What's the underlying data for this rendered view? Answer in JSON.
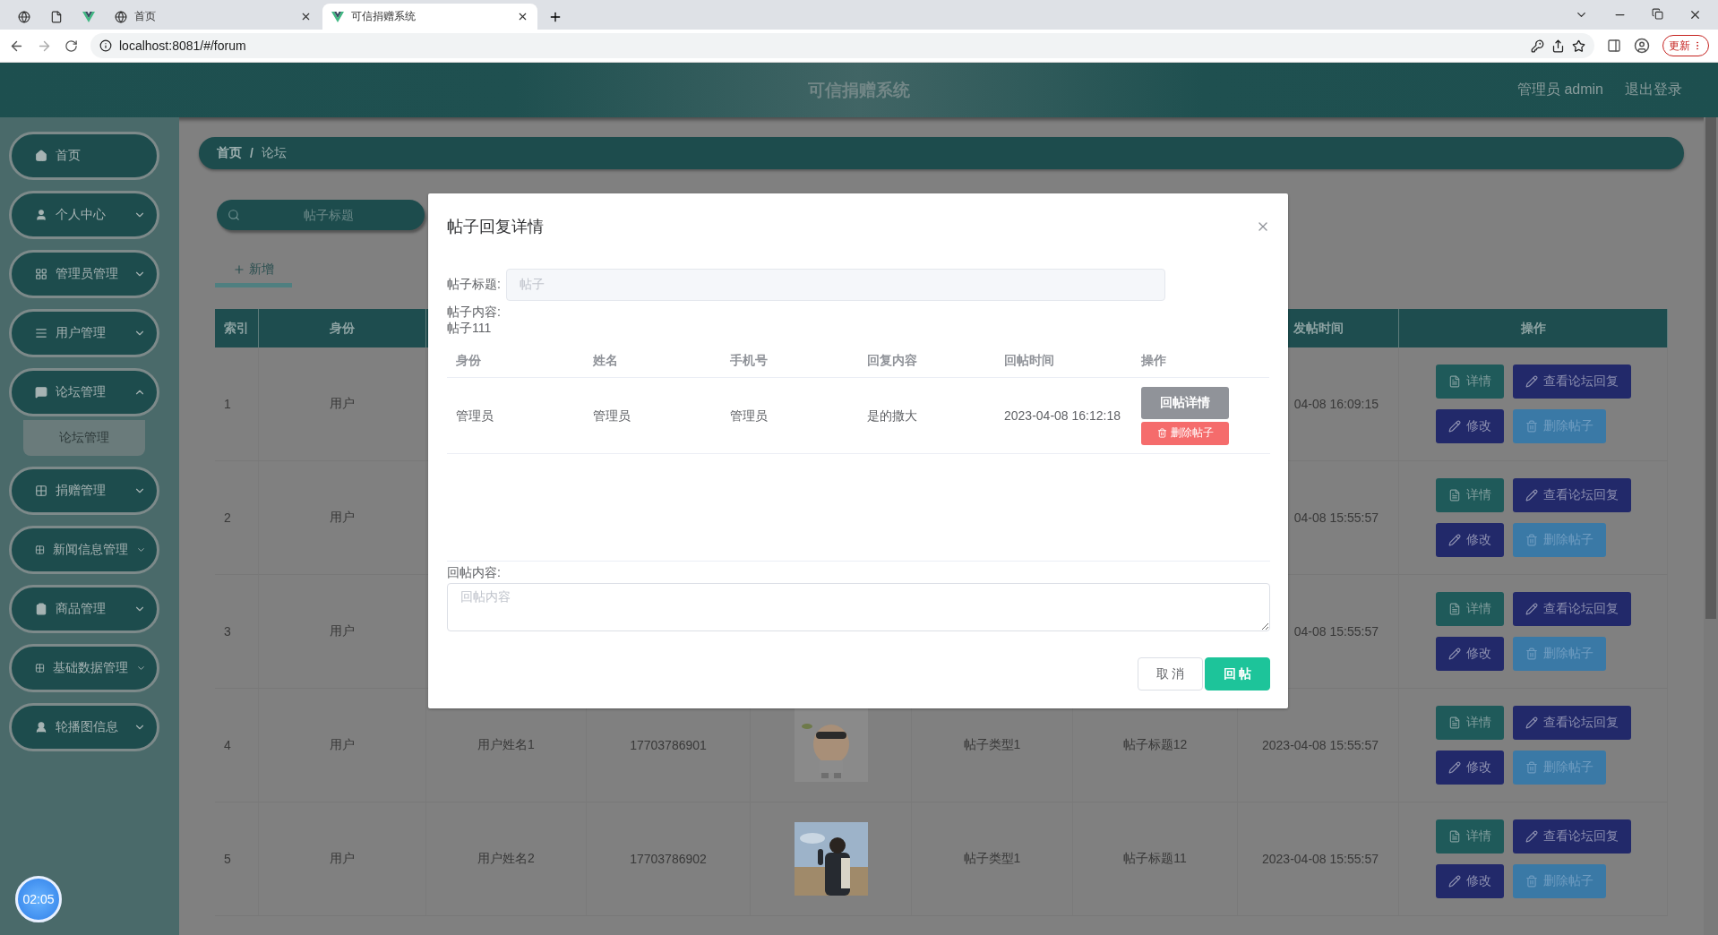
{
  "browser": {
    "tabs": [
      {
        "kind": "icon-only",
        "selected": false
      },
      {
        "kind": "icon-only",
        "selected": false
      },
      {
        "kind": "icon-only",
        "selected": false
      },
      {
        "kind": "titled",
        "title": "首页",
        "selected": false
      },
      {
        "kind": "titled",
        "title": "可信捐赠系统",
        "selected": true
      }
    ],
    "address": "localhost:8081/#/forum",
    "update_button": "更新"
  },
  "header": {
    "title": "可信捐赠系统",
    "user": "管理员 admin",
    "logout": "退出登录"
  },
  "sidebar": {
    "items": [
      {
        "kind": "link",
        "label": "首页"
      },
      {
        "kind": "menu",
        "label": "个人中心",
        "expanded": false
      },
      {
        "kind": "menu",
        "label": "管理员管理",
        "expanded": false
      },
      {
        "kind": "menu",
        "label": "用户管理",
        "expanded": false
      },
      {
        "kind": "menu",
        "label": "论坛管理",
        "expanded": true,
        "children": [
          {
            "label": "论坛管理"
          }
        ]
      },
      {
        "kind": "menu",
        "label": "捐赠管理",
        "expanded": false
      },
      {
        "kind": "menu",
        "label": "新闻信息管理",
        "expanded": false
      },
      {
        "kind": "menu",
        "label": "商品管理",
        "expanded": false
      },
      {
        "kind": "menu",
        "label": "基础数据管理",
        "expanded": false
      },
      {
        "kind": "menu",
        "label": "轮播图信息",
        "expanded": false
      }
    ]
  },
  "recorder_badge": "02:05",
  "breadcrumb": [
    "首页",
    "/",
    "论坛"
  ],
  "search": {
    "placeholder": "帖子标题"
  },
  "add_button": "新增",
  "table": {
    "headers": {
      "index": "索引",
      "identity": "身份",
      "time": "发帖时间",
      "actions": "操作"
    },
    "rows": [
      {
        "index": "1",
        "identity": "用户",
        "time": "04-08 16:09:15",
        "actions": [
          {
            "kind": "detail",
            "label": "详情"
          },
          {
            "kind": "replies",
            "label": "查看论坛回复"
          },
          {
            "kind": "edit",
            "label": "修改"
          },
          {
            "kind": "delete",
            "label": "删除帖子"
          }
        ]
      },
      {
        "index": "2",
        "identity": "用户",
        "time": "04-08 15:55:57",
        "actions": [
          {
            "kind": "detail",
            "label": "详情"
          },
          {
            "kind": "replies",
            "label": "查看论坛回复"
          },
          {
            "kind": "edit",
            "label": "修改"
          },
          {
            "kind": "delete",
            "label": "删除帖子"
          }
        ]
      },
      {
        "index": "3",
        "identity": "用户",
        "time": "04-08 15:55:57",
        "actions": [
          {
            "kind": "detail",
            "label": "详情"
          },
          {
            "kind": "replies",
            "label": "查看论坛回复"
          },
          {
            "kind": "edit",
            "label": "修改"
          },
          {
            "kind": "delete",
            "label": "删除帖子"
          }
        ]
      },
      {
        "index": "4",
        "identity": "用户",
        "name": "用户姓名1",
        "phone": "17703786901",
        "image": {
          "kind": "picture"
        },
        "type": "帖子类型1",
        "title": "帖子标题12",
        "time": "2023-04-08 15:55:57",
        "actions": [
          {
            "kind": "detail",
            "label": "详情"
          },
          {
            "kind": "replies",
            "label": "查看论坛回复"
          },
          {
            "kind": "edit",
            "label": "修改"
          },
          {
            "kind": "delete",
            "label": "删除帖子"
          }
        ]
      },
      {
        "index": "5",
        "identity": "用户",
        "name": "用户姓名2",
        "phone": "17703786902",
        "image": {
          "kind": "picture"
        },
        "type": "帖子类型1",
        "title": "帖子标题11",
        "time": "2023-04-08 15:55:57",
        "actions": [
          {
            "kind": "detail",
            "label": "详情"
          },
          {
            "kind": "replies",
            "label": "查看论坛回复"
          },
          {
            "kind": "edit",
            "label": "修改"
          },
          {
            "kind": "delete",
            "label": "删除帖子"
          }
        ]
      }
    ]
  },
  "modal": {
    "title": "帖子回复详情",
    "title_field": {
      "label": "帖子标题:",
      "value": "帖子",
      "disabled": true
    },
    "content_label": "帖子内容:",
    "content": "帖子111",
    "replies": {
      "columns": [
        "身份",
        "姓名",
        "手机号",
        "回复内容",
        "回帖时间",
        "操作"
      ],
      "rows": [
        {
          "cells": [
            "管理员",
            "管理员",
            "管理员",
            "是的撒大",
            "2023-04-08 16:12:18"
          ],
          "actions": [
            {
              "kind": "detail",
              "label": "回帖详情"
            },
            {
              "kind": "delete",
              "label": "删除帖子"
            }
          ]
        }
      ]
    },
    "reply_field": {
      "label": "回帖内容:",
      "placeholder": "回帖内容"
    },
    "buttons": [
      {
        "kind": "cancel",
        "label": "取 消"
      },
      {
        "kind": "submit",
        "label": "回 帖"
      }
    ]
  }
}
